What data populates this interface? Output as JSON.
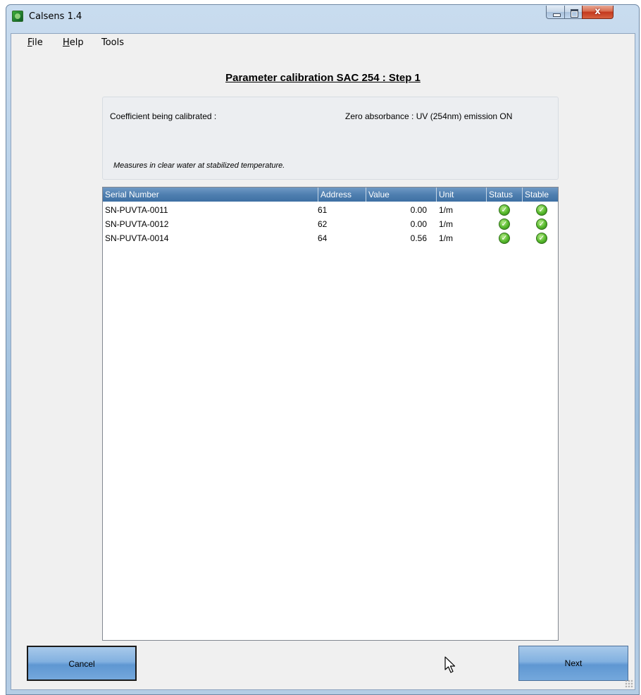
{
  "window": {
    "title": "Calsens 1.4",
    "close_glyph": "x"
  },
  "menu": [
    {
      "label": "File",
      "accel": "F",
      "rest": "ile"
    },
    {
      "label": "Help",
      "accel": "H",
      "rest": "elp"
    },
    {
      "label": "Tools",
      "accel": "",
      "rest": "Tools"
    }
  ],
  "page": {
    "title": "Parameter calibration SAC 254 :  Step 1",
    "coefficient_label": "Coefficient being calibrated :",
    "coefficient_value": "Zero absorbance : UV (254nm) emission ON",
    "note": "Measures in clear water at stabilized temperature."
  },
  "table": {
    "columns": [
      "Serial Number",
      "Address",
      "Value",
      "Unit",
      "Status",
      "Stable"
    ],
    "rows": [
      {
        "serial": "SN-PUVTA-0011",
        "address": "61",
        "value": "0.00",
        "unit": "1/m",
        "status": "ok",
        "stable": "ok"
      },
      {
        "serial": "SN-PUVTA-0012",
        "address": "62",
        "value": "0.00",
        "unit": "1/m",
        "status": "ok",
        "stable": "ok"
      },
      {
        "serial": "SN-PUVTA-0014",
        "address": "64",
        "value": "0.56",
        "unit": "1/m",
        "status": "ok",
        "stable": "ok"
      }
    ]
  },
  "buttons": {
    "cancel": "Cancel",
    "next": "Next"
  },
  "icons": {
    "app": "calsens-app-icon",
    "status_ok": "green-check-icon"
  },
  "colors": {
    "header_bg": "#4f7fb0",
    "button_bg": "#82b1e0",
    "check_green": "#55b82b"
  }
}
